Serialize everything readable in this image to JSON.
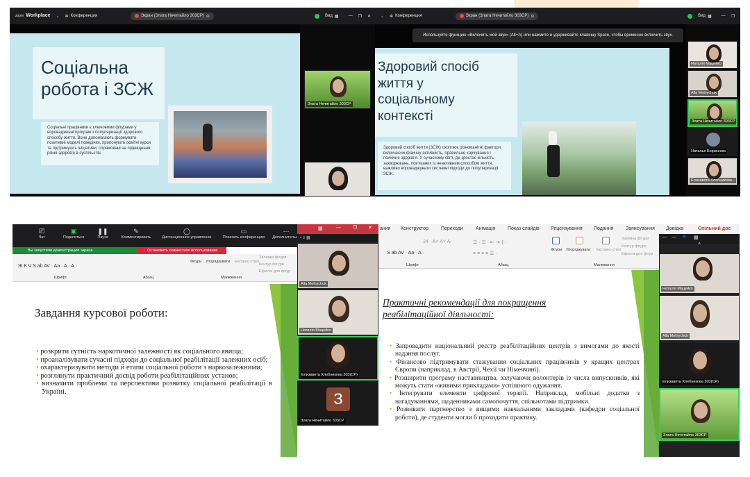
{
  "q1": {
    "zoom_top": "zoom",
    "zoom_bottom": "Workplace",
    "conference": "Конференция",
    "screen_share": "Экран (Злата Нечитайло 303СР)",
    "view": "Вид",
    "slide_title": "Соціальна робота і ЗСЖ",
    "slide_body": "Соціальні працівники є ключовими фігурами у впровадженні програм з популяризації здорового способу життя. Вони допомагають формувати позитивні моделі поведінки, пропонують освітні курси та підтримують ініціативи, спрямовані на підвищення рівня здоров'я в суспільстві.",
    "tile_name": "Злата Нечитайло 303СР"
  },
  "q2": {
    "conference": "Конференция",
    "screen_share": "Экран (Злата Нечитайло 303СР)",
    "view": "Вид",
    "tip": "Используйте функцию «Включить мой звук» (Alt+A) или нажмите и удерживайте клавишу Space, чтобы временно включить звук.",
    "slide_title": "Здоровий спосіб життя у соціальному контексті",
    "slide_body": "Здоровий спосіб життя (ЗСЖ) охоплює різноманітні фактори, включаючи фізичну активність, правильне харчування і психічне здоров'я. У сучасному світі, де зростає кількість захворювань, пов'язаних із неактивним способом життя, важливо впроваджувати системні підходи до популяризації ЗСЖ.",
    "participants": [
      "Наталія Мацейко",
      "Alla Melnychuk",
      "Злата Нечитайло 303СР",
      "Наталья Борисенко",
      "Елизавета Хлебникова..."
    ]
  },
  "q3": {
    "toolbar": [
      "Чат",
      "Поделиться",
      "Пауза",
      "Комментировать",
      "Дистанционное управление",
      "Показать конференцию",
      "Дополнительно"
    ],
    "sharing_notice": "Вы запустили демонстрацию экрана",
    "stop_sharing": "Остановить совместное использование",
    "ribbon_groups": [
      "Шрифт",
      "Абзац",
      "Малювання"
    ],
    "ribbon_labels": [
      "Фігури",
      "Упорядкувати",
      "Експрес-стилі",
      "Заливка фігури",
      "Контур фігури",
      "Ефекти для фігур"
    ],
    "slide_title": "Завдання курсової роботи:",
    "bullets": [
      "розкрити сутність наркотичної залежності як соціального явища;",
      "проаналізувати сучасні підходи до соціальної реабілітації залежних осіб;",
      "охарактеризувати методи й етапи соціальної роботи з наркозалежними;",
      "розглянути практичний доєвід роботи реабілітаційних установ;",
      "визначити проблеми та перспективи розвитку соціальної реабілітації в Україні."
    ],
    "participants": [
      "Alla Melnychuk",
      "Наталія Мацейко",
      "Елизавета Хлебникова 303(СР)",
      "Злата Нечитайло 303СР"
    ],
    "avatar_letter": "З"
  },
  "q4": {
    "menu": [
      "ания",
      "Конструктор",
      "Переходи",
      "Анімація",
      "Показ слайдів",
      "Рецензування",
      "Подання",
      "Записування",
      "Довідка",
      "Спільний дос"
    ],
    "ribbon_groups": [
      "Шрифт",
      "Абзац",
      "Малювання"
    ],
    "ribbon_labels": [
      "Фігури",
      "Упорядкувати",
      "Експрес-стилі",
      "Заливка фігури",
      "Контур фігури",
      "Ефекти для фігур"
    ],
    "slide_title_line1": "Практичні рекомендації для покращення",
    "slide_title_line2": "реабілітаційної діяльності:",
    "bullets": [
      "Запровадити національний реєстр реабілітаційних центрів з вимогами до якості надання послуг.",
      "Фінансово підтримувати стажування соціальних працівників у кращих центрах Європи (наприклад, в Австрії, Чехії чи Німеччині).",
      "Розширити програму наставництва, залучаючи волонтерів із числа випускників, які можуть стати «живими прикладами» успішного одужання.",
      "Інтегрувати елементи цифрової терапії. Наприклад, мобільні додатки з нагадуваннями, щоденниками самопочуття, спільнотами підтримки.",
      "Розвивати партнерство з вищими навчальними закладами (кафедри соціальної роботи), де студенти могли б проходити практику."
    ],
    "participants": [
      "Наталія Мацейко",
      "Alla Melnychuk",
      "Елизавета Хлебникова 303(СР)",
      "Злата Нечитайло 303СР"
    ]
  }
}
